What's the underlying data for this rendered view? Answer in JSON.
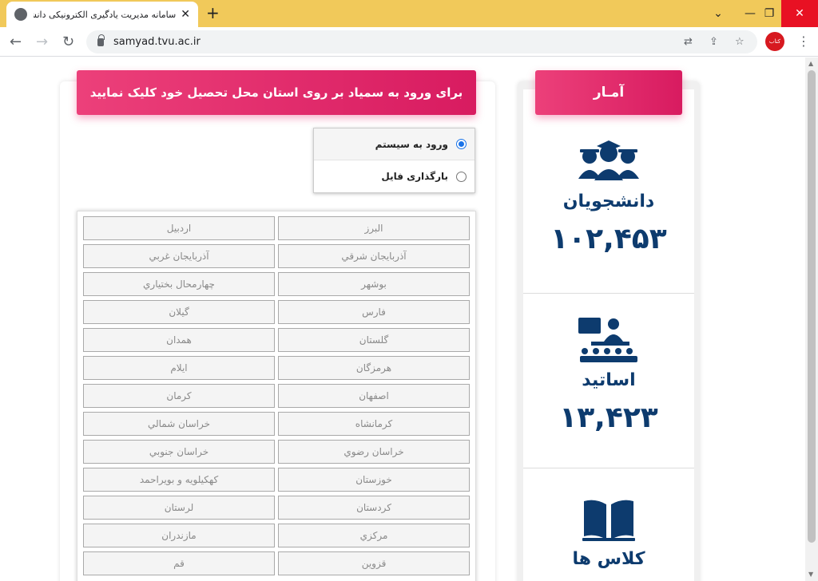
{
  "browser": {
    "tab_title": "سامانه مدیریت یادگیری الکترونیکی دانشگاه فـ",
    "url": "samyad.tvu.ac.ir",
    "extension_label": "کتاب"
  },
  "page": {
    "banner_text": "برای ورود به سمیاد بر روی استان محل تحصیل خود کلیک نمایید",
    "radio_options": [
      {
        "label": "ورود به سیستم",
        "checked": true
      },
      {
        "label": "بارگذاری فایل",
        "checked": false
      }
    ],
    "provinces": [
      "البرز",
      "اردبیل",
      "آذربایجان شرقي",
      "آذربايجان غربي",
      "بوشهر",
      "چهارمحال بختياري",
      "فارس",
      "گيلان",
      "گلستان",
      "همدان",
      "هرمزگان",
      "ايلام",
      "اصفهان",
      "كرمان",
      "كرمانشاه",
      "خراسان شمالي",
      "خراسان رضوي",
      "خراسان جنوبي",
      "خوزستان",
      "كهكيلويه و بويراحمد",
      "كردستان",
      "لرستان",
      "مركزي",
      "مازندران",
      "قزوين",
      "قم"
    ]
  },
  "stats": {
    "title": "آمـار",
    "students_label": "دانشجویان",
    "students_value": "۱۰۲,۴۵۳",
    "teachers_label": "اساتید",
    "teachers_value": "۱۳,۴۲۳",
    "classes_label": "کلاس ها"
  },
  "colors": {
    "accent_pink": "#e91e63",
    "stat_navy": "#0d3b6e",
    "chrome_tabbar": "#f1c95a"
  }
}
